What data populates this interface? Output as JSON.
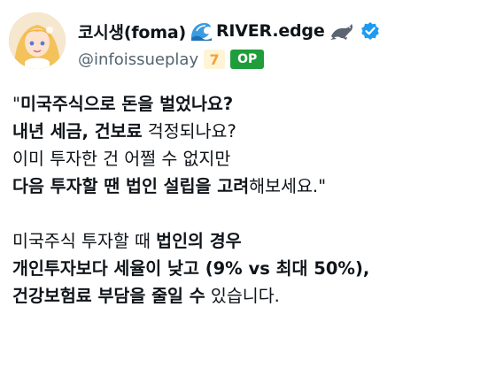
{
  "author": {
    "display_name": "코시생(foma)",
    "suffix": "RIVER.edge",
    "handle": "@infoissueplay",
    "level_badge": "7",
    "op_badge": "OP",
    "colors": {
      "verified": "#1d9bf0",
      "op_badge": "#1f9d3a",
      "level_badge": "#f2a23a",
      "handle": "#536471"
    },
    "icons": [
      "wave-icon",
      "seal-icon",
      "verified-badge-icon"
    ]
  },
  "tweet": {
    "lines": [
      [
        {
          "text": "\"",
          "bold": false
        },
        {
          "text": "미국주식으로 돈을 벌었나요?",
          "bold": true
        }
      ],
      [
        {
          "text": "내년 세금, 건보료",
          "bold": true
        },
        {
          "text": " 걱정되나요?",
          "bold": false
        }
      ],
      [
        {
          "text": "이미 투자한 건 어쩔 수 없지만",
          "bold": false
        }
      ],
      [
        {
          "text": "다음 투자할 땐 법인 설립을 고려",
          "bold": true
        },
        {
          "text": "해보세요.\"",
          "bold": false
        }
      ],
      [],
      [
        {
          "text": "미국주식 투자할 때 ",
          "bold": false
        },
        {
          "text": "법인의 경우",
          "bold": true
        }
      ],
      [
        {
          "text": "개인투자보다 세율이 낮고 (9% vs 최대 50%),",
          "bold": true
        }
      ],
      [
        {
          "text": "건강보험료 부담을 줄일 수",
          "bold": true
        },
        {
          "text": " 있습니다.",
          "bold": false
        }
      ]
    ]
  }
}
